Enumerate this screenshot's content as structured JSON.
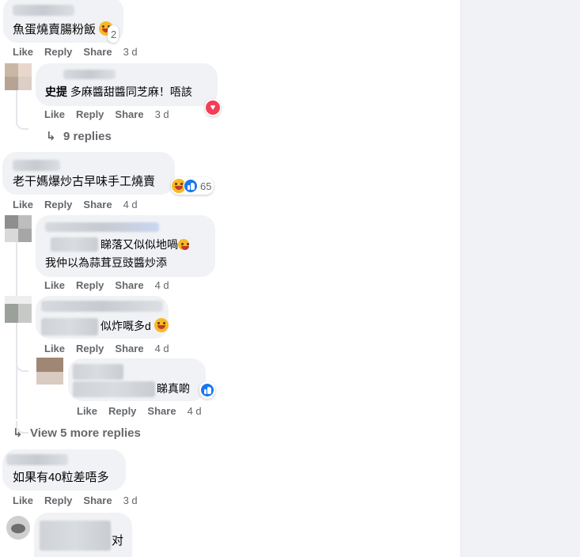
{
  "actions": {
    "like": "Like",
    "reply": "Reply",
    "share": "Share"
  },
  "comments": [
    {
      "id": "c1",
      "text": "魚蛋燒賣腸粉飯",
      "reaction_count": "2",
      "time": "3 d"
    },
    {
      "id": "r1",
      "author": "史提",
      "text": "多麻醬甜醬同芝麻！唔該",
      "time": "3 d"
    },
    {
      "id": "c1_more",
      "replies_label": "9 replies"
    },
    {
      "id": "c2",
      "text": "老干媽爆炒古早味手工燒賣",
      "reaction_count": "65",
      "time": "4 d"
    },
    {
      "id": "r2",
      "text_line1": "睇落又似似地喎",
      "text_line2": "我仲以為蒜茸豆豉醬炒添",
      "time": "4 d"
    },
    {
      "id": "r3",
      "text": "似炸嘅多d",
      "time": "4 d"
    },
    {
      "id": "r3a",
      "text": "睇真啲",
      "time": "4 d"
    },
    {
      "id": "c2_more",
      "replies_label": "View 5 more replies"
    },
    {
      "id": "c3",
      "text": "如果有40粒差唔多",
      "time": "3 d"
    },
    {
      "id": "c4",
      "text": "对"
    }
  ],
  "icons": {
    "reply_arrow": "reply-arrow-icon"
  },
  "colors": {
    "bubble": "#f0f2f5",
    "muted": "#65676b",
    "like_blue": "#1877f2",
    "love_red": "#f33e58",
    "haha_yellow": "#f7b928"
  }
}
